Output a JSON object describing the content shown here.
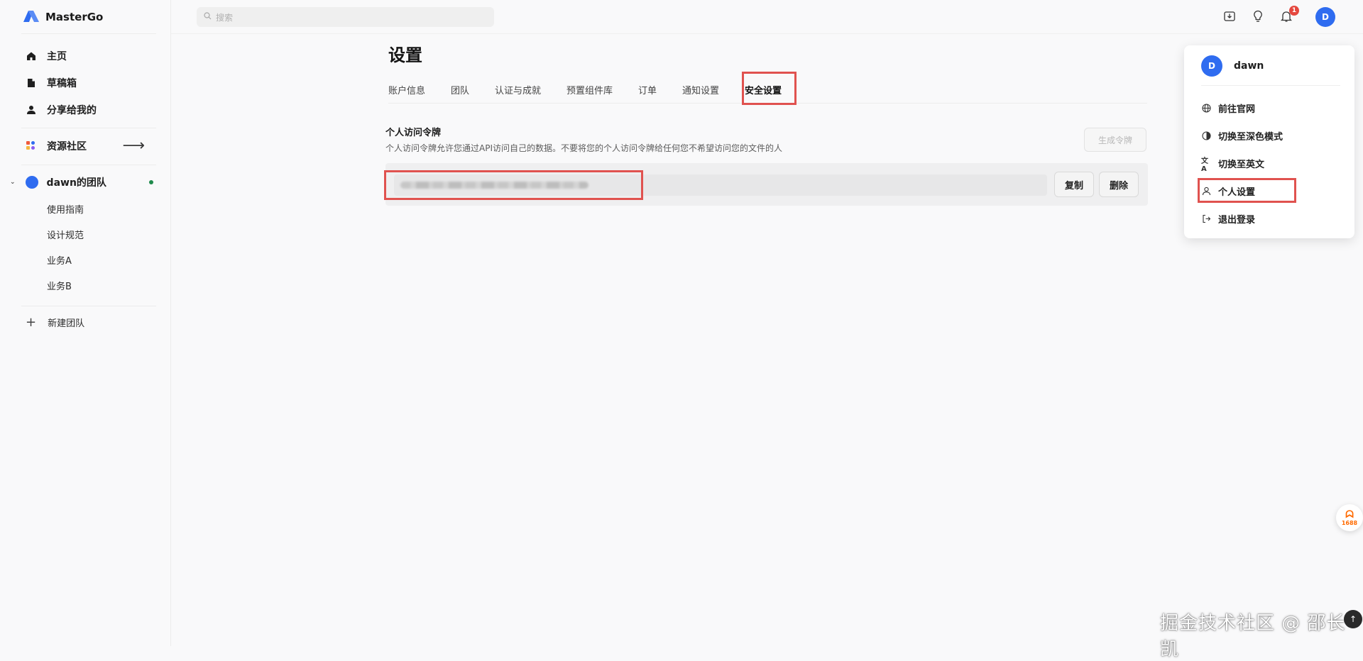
{
  "app": {
    "brand": "MasterGo",
    "brand_color": "#2f6cf0"
  },
  "sidebar": {
    "nav": [
      {
        "label": "主页",
        "icon": "home-icon"
      },
      {
        "label": "草稿箱",
        "icon": "file-icon"
      },
      {
        "label": "分享给我的",
        "icon": "person-icon"
      }
    ],
    "community": {
      "label": "资源社区",
      "icon": "apps-icon"
    },
    "team": {
      "name": "dawn的团队",
      "status": "online"
    },
    "team_items": [
      "使用指南",
      "设计规范",
      "业务A",
      "业务B"
    ],
    "new_team": "新建团队"
  },
  "topbar": {
    "search_placeholder": "搜索",
    "notification_count": "1",
    "avatar_initial": "D"
  },
  "main": {
    "title": "设置",
    "tabs": [
      {
        "label": "账户信息",
        "active": false
      },
      {
        "label": "团队",
        "active": false
      },
      {
        "label": "认证与成就",
        "active": false
      },
      {
        "label": "预置组件库",
        "active": false
      },
      {
        "label": "订单",
        "active": false
      },
      {
        "label": "通知设置",
        "active": false
      },
      {
        "label": "安全设置",
        "active": true
      }
    ],
    "token_section": {
      "title": "个人访问令牌",
      "description": "个人访问令牌允许您通过API访问自己的数据。不要将您的个人访问令牌给任何您不希望访问您的文件的人",
      "generate_label": "生成令牌",
      "copy_label": "复制",
      "delete_label": "删除"
    }
  },
  "user_menu": {
    "username": "dawn",
    "avatar_initial": "D",
    "items": [
      {
        "label": "前往官网",
        "icon": "globe-icon"
      },
      {
        "label": "切换至深色模式",
        "icon": "contrast-icon"
      },
      {
        "label": "切换至英文",
        "icon": "translate-icon"
      },
      {
        "label": "个人设置",
        "icon": "user-icon"
      },
      {
        "label": "退出登录",
        "icon": "logout-icon"
      }
    ]
  },
  "overlays": {
    "float_badge": "1688",
    "watermark": "掘金技术社区 @ 邵长凯"
  },
  "colors": {
    "highlight": "#e0524f",
    "accent": "#2f6cf0",
    "badge": "#e5483f"
  }
}
